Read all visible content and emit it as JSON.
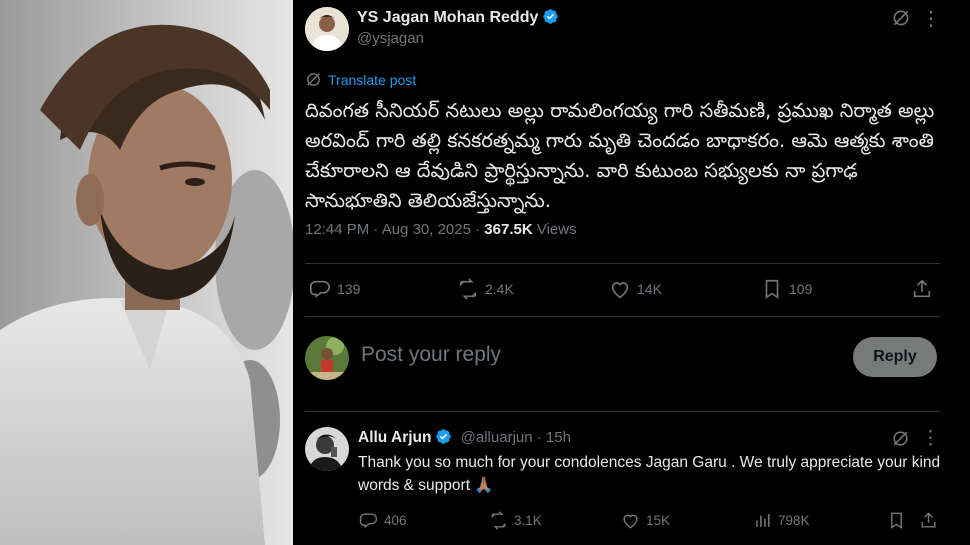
{
  "post": {
    "author_name": "YS Jagan Mohan Reddy",
    "author_handle": "@ysjagan",
    "translate_label": "Translate post",
    "text": "దివంగత సీనియర్ నటులు అల్లు రామలింగయ్య గారి సతీమణి, ప్రముఖ నిర్మాత అల్లు అరవింద్ గారి తల్లి కనకరత్నమ్మ గారు మృతి చెందడం బాధాకరం. ఆమె ఆత్మకు శాంతి చేకూరాలని ఆ దేవుడిని ప్రార్థిస్తున్నాను. వారి కుటుంబ సభ్యులకు నా ప్రగాఢ సానుభూతిని తెలియజేస్తున్నాను.",
    "time": "12:44 PM · Aug 30, 2025 ·",
    "views_count": "367.5K",
    "views_label": "Views",
    "stats": {
      "replies": "139",
      "reposts": "2.4K",
      "likes": "14K",
      "bookmarks": "109"
    }
  },
  "composer": {
    "placeholder": "Post your reply",
    "reply_button": "Reply"
  },
  "reply": {
    "author_name": "Allu Arjun",
    "author_handle": "@alluarjun",
    "time": "· 15h",
    "text": "Thank you so much for your condolences Jagan Garu . We truly appreciate your kind words & support 🙏🏽",
    "stats": {
      "replies": "406",
      "reposts": "3.1K",
      "likes": "15K",
      "views": "798K"
    }
  },
  "colors": {
    "verified": "#1d9bf0",
    "link": "#1d9bf0",
    "muted": "#71767b",
    "background": "#000000"
  }
}
